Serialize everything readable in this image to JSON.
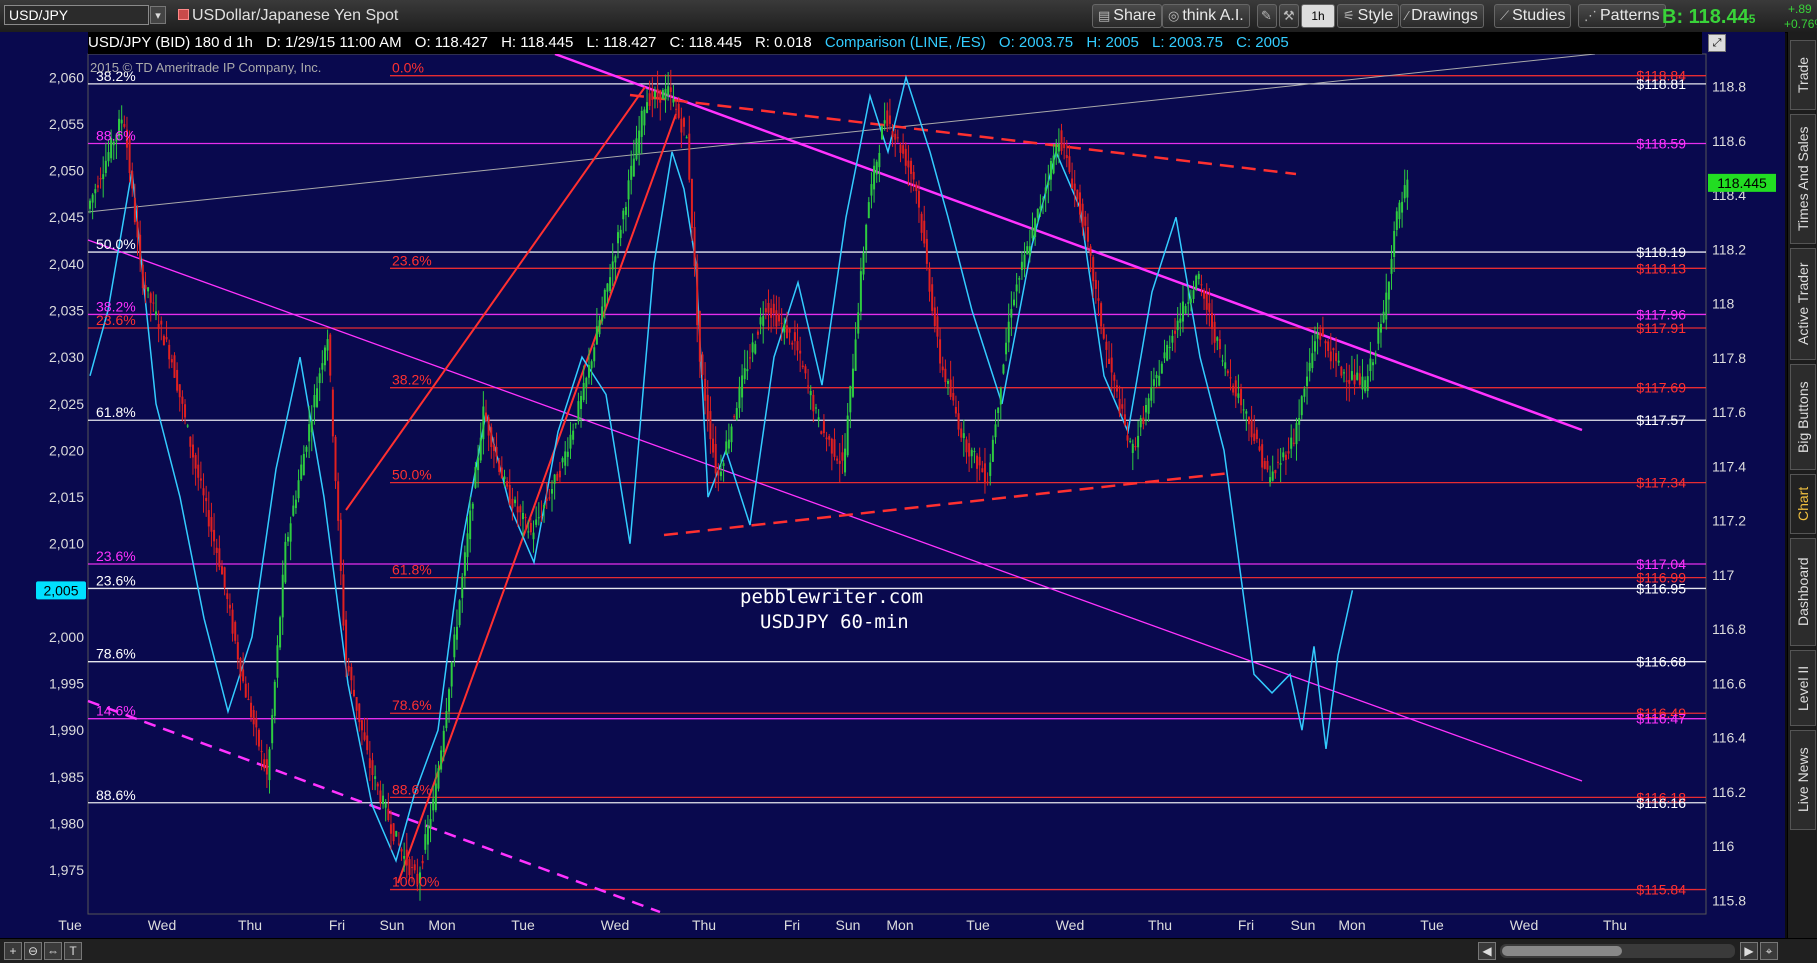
{
  "toolbar": {
    "symbol": "USD/JPY",
    "description": "USDollar/Japanese Yen Spot",
    "buttons": {
      "share": "Share",
      "think_ai": "think A.I.",
      "interval": "1h",
      "style": "Style",
      "drawings": "Drawings",
      "studies": "Studies",
      "patterns": "Patterns"
    },
    "bid": "B: 118.44",
    "bid_sub": "5",
    "change_abs": "+.89",
    "change_pct": "+0.76%"
  },
  "infobar": {
    "title": "USD/JPY (BID) 180 d 1h",
    "date": "D: 1/29/15 11:00 AM",
    "open": "O: 118.427",
    "high": "H: 118.445",
    "low": "L: 118.427",
    "close": "C: 118.445",
    "range": "R: 0.018",
    "comparison": "Comparison (LINE, /ES)",
    "cmp_open": "O: 2003.75",
    "cmp_high": "H: 2005",
    "cmp_low": "L: 2003.75",
    "cmp_close": "C: 2005"
  },
  "copyright": "2015 © TD Ameritrade IP Company, Inc.",
  "watermark": {
    "line1": "pebblewriter.com",
    "line2": "USDJPY 60-min"
  },
  "side_tabs": [
    "Trade",
    "Times And Sales",
    "Active Trader",
    "Big Buttons",
    "Chart",
    "Dashboard",
    "Level II",
    "Live News"
  ],
  "colors": {
    "background": "#09094e",
    "comparison_line": "#33ccff",
    "up_candle": "#2ecc40",
    "down_candle": "#e02020",
    "fib_red": "#ff3030",
    "fib_magenta": "#ff33ff",
    "fib_white": "#ffffff",
    "bid_green": "#39d339"
  },
  "chart_data": {
    "type": "candlestick",
    "title": "USDJPY 60-min",
    "x_axis_labels": [
      "Tue",
      "Wed",
      "Thu",
      "Fri",
      "Sun",
      "Mon",
      "Tue",
      "Wed",
      "Thu",
      "Fri",
      "Sun",
      "Mon",
      "Tue",
      "Wed",
      "Thu",
      "Fri",
      "Sun",
      "Mon",
      "Tue",
      "Wed",
      "Thu"
    ],
    "right_axis": {
      "label": "USD/JPY",
      "ticks": [
        115.8,
        116,
        116.2,
        116.4,
        116.6,
        116.8,
        117,
        117.2,
        117.4,
        117.6,
        117.8,
        118,
        118.2,
        118.4,
        118.6,
        118.8
      ],
      "ylim": [
        115.75,
        118.92
      ],
      "current_value": "118.445"
    },
    "left_axis": {
      "label": "/ES",
      "ticks": [
        "1,975",
        "1,980",
        "1,985",
        "1,990",
        "1,995",
        "2,000",
        "2,005",
        "2,010",
        "2,015",
        "2,020",
        "2,025",
        "2,030",
        "2,035",
        "2,040",
        "2,045",
        "2,050",
        "2,055",
        "2,060"
      ],
      "ylim": [
        1970.3,
        2062.5
      ],
      "current_value": "2,005"
    },
    "price_labels": [
      {
        "text": "$118.84",
        "color": "#ff3030"
      },
      {
        "text": "$118.81",
        "color": "#ffffff"
      },
      {
        "text": "$118.59",
        "color": "#ff33ff"
      },
      {
        "text": "$118.19",
        "color": "#ffffff"
      },
      {
        "text": "$118.13",
        "color": "#ff3030"
      },
      {
        "text": "$117.96",
        "color": "#ff33ff"
      },
      {
        "text": "$117.91",
        "color": "#ff3030"
      },
      {
        "text": "$117.69",
        "color": "#ff3030"
      },
      {
        "text": "$117.57",
        "color": "#ffffff"
      },
      {
        "text": "$117.34",
        "color": "#ff3030"
      },
      {
        "text": "$117.04",
        "color": "#ff33ff"
      },
      {
        "text": "$116.99",
        "color": "#ff3030"
      },
      {
        "text": "$116.95",
        "color": "#ffffff"
      },
      {
        "text": "$116.68",
        "color": "#ffffff"
      },
      {
        "text": "$116.49",
        "color": "#ff3030"
      },
      {
        "text": "$116.47",
        "color": "#ff33ff"
      },
      {
        "text": "$116.18",
        "color": "#ff3030"
      },
      {
        "text": "$116.16",
        "color": "#ffffff"
      },
      {
        "text": "$115.84",
        "color": "#ff3030"
      }
    ],
    "fib_labels_left": [
      {
        "text": "38.2%",
        "color": "#ffffff"
      },
      {
        "text": "88.6%",
        "color": "#ff33ff"
      },
      {
        "text": "50.0%",
        "color": "#ffffff"
      },
      {
        "text": "38.2%",
        "color": "#ff33ff"
      },
      {
        "text": "23.6%",
        "color": "#ff3030"
      },
      {
        "text": "61.8%",
        "color": "#ffffff"
      },
      {
        "text": "23.6%",
        "color": "#ff33ff"
      },
      {
        "text": "23.6%",
        "color": "#ffffff"
      },
      {
        "text": "78.6%",
        "color": "#ffffff"
      },
      {
        "text": "14.6%",
        "color": "#ff33ff"
      },
      {
        "text": "88.6%",
        "color": "#ffffff"
      }
    ],
    "fib_labels_inner": [
      {
        "text": "0.0%",
        "color": "#ff3030"
      },
      {
        "text": "23.6%",
        "color": "#ff3030"
      },
      {
        "text": "38.2%",
        "color": "#ff3030"
      },
      {
        "text": "50.0%",
        "color": "#ff3030"
      },
      {
        "text": "61.8%",
        "color": "#ff3030"
      },
      {
        "text": "78.6%",
        "color": "#ff3030"
      },
      {
        "text": "88.6%",
        "color": "#ff3030"
      },
      {
        "text": "100.0%",
        "color": "#ff3030"
      }
    ],
    "price_path": [
      [
        0,
        118.35
      ],
      [
        30,
        118.7
      ],
      [
        45,
        118.1
      ],
      [
        70,
        117.8
      ],
      [
        90,
        117.4
      ],
      [
        110,
        117.05
      ],
      [
        130,
        116.6
      ],
      [
        150,
        116.25
      ],
      [
        165,
        117.1
      ],
      [
        185,
        117.55
      ],
      [
        200,
        117.9
      ],
      [
        215,
        116.7
      ],
      [
        235,
        116.3
      ],
      [
        255,
        116.05
      ],
      [
        265,
        115.95
      ],
      [
        275,
        115.87
      ],
      [
        290,
        116.2
      ],
      [
        310,
        116.9
      ],
      [
        330,
        117.6
      ],
      [
        350,
        117.3
      ],
      [
        370,
        117.15
      ],
      [
        395,
        117.4
      ],
      [
        415,
        117.7
      ],
      [
        445,
        118.3
      ],
      [
        465,
        118.75
      ],
      [
        485,
        118.78
      ],
      [
        500,
        118.6
      ],
      [
        510,
        117.8
      ],
      [
        525,
        117.35
      ],
      [
        545,
        117.7
      ],
      [
        565,
        118.0
      ],
      [
        590,
        117.85
      ],
      [
        610,
        117.55
      ],
      [
        630,
        117.4
      ],
      [
        650,
        118.35
      ],
      [
        665,
        118.7
      ],
      [
        690,
        118.45
      ],
      [
        710,
        117.8
      ],
      [
        730,
        117.5
      ],
      [
        750,
        117.35
      ],
      [
        770,
        118.0
      ],
      [
        790,
        118.3
      ],
      [
        810,
        118.62
      ],
      [
        830,
        118.3
      ],
      [
        850,
        117.8
      ],
      [
        870,
        117.45
      ],
      [
        885,
        117.65
      ],
      [
        905,
        117.9
      ],
      [
        925,
        118.1
      ],
      [
        945,
        117.8
      ],
      [
        965,
        117.6
      ],
      [
        985,
        117.35
      ],
      [
        1005,
        117.5
      ],
      [
        1025,
        117.9
      ],
      [
        1045,
        117.75
      ],
      [
        1065,
        117.7
      ],
      [
        1080,
        117.95
      ],
      [
        1090,
        118.3
      ],
      [
        1100,
        118.44
      ]
    ],
    "comparison_path": [
      [
        0,
        2028
      ],
      [
        15,
        2035
      ],
      [
        35,
        2050
      ],
      [
        55,
        2025
      ],
      [
        75,
        2015
      ],
      [
        95,
        2002
      ],
      [
        115,
        1992
      ],
      [
        135,
        2000
      ],
      [
        155,
        2018
      ],
      [
        175,
        2030
      ],
      [
        195,
        2015
      ],
      [
        215,
        1995
      ],
      [
        235,
        1982
      ],
      [
        255,
        1976
      ],
      [
        270,
        1983
      ],
      [
        290,
        1990
      ],
      [
        310,
        2010
      ],
      [
        330,
        2024
      ],
      [
        350,
        2014
      ],
      [
        370,
        2008
      ],
      [
        390,
        2022
      ],
      [
        410,
        2030
      ],
      [
        430,
        2026
      ],
      [
        450,
        2010
      ],
      [
        470,
        2040
      ],
      [
        485,
        2052
      ],
      [
        495,
        2048
      ],
      [
        505,
        2040
      ],
      [
        515,
        2015
      ],
      [
        530,
        2020
      ],
      [
        550,
        2012
      ],
      [
        570,
        2030
      ],
      [
        590,
        2038
      ],
      [
        610,
        2027
      ],
      [
        630,
        2045
      ],
      [
        650,
        2058
      ],
      [
        665,
        2052
      ],
      [
        680,
        2060
      ],
      [
        700,
        2052
      ],
      [
        715,
        2045
      ],
      [
        735,
        2035
      ],
      [
        760,
        2025
      ],
      [
        785,
        2042
      ],
      [
        805,
        2052
      ],
      [
        825,
        2046
      ],
      [
        845,
        2028
      ],
      [
        865,
        2022
      ],
      [
        885,
        2037
      ],
      [
        905,
        2045
      ],
      [
        925,
        2030
      ],
      [
        945,
        2020
      ],
      [
        970,
        1996
      ],
      [
        985,
        1994
      ],
      [
        1000,
        1996
      ],
      [
        1010,
        1990
      ],
      [
        1020,
        1999
      ],
      [
        1030,
        1988
      ],
      [
        1040,
        1998
      ],
      [
        1052,
        2005
      ]
    ]
  }
}
